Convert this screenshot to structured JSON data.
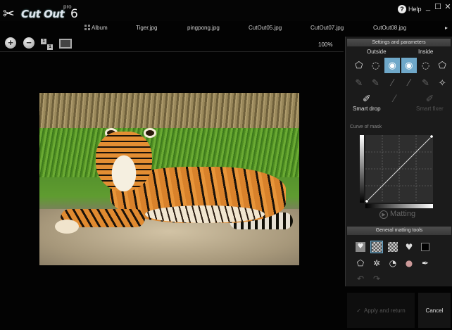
{
  "app": {
    "logo_text": "Cut Out",
    "logo_pro": "pro",
    "logo_version": "6",
    "help_label": "Help"
  },
  "window_controls": {
    "minimize": "_",
    "maximize": "☐",
    "close": "✕"
  },
  "tabs": [
    {
      "label": "Album",
      "icon": "album-grid-icon"
    },
    {
      "label": "Tiger.jpg"
    },
    {
      "label": "pingpong.jpg"
    },
    {
      "label": "CutOut05.jpg"
    },
    {
      "label": "CutOut07.jpg"
    },
    {
      "label": "CutOut08.jpg"
    }
  ],
  "tab_overflow": "▸",
  "toolbar": {
    "zoom_in_icon": "zoom-in-icon",
    "zoom_out_icon": "zoom-out-icon",
    "one_to_one_top": "1",
    "one_to_one_bottom": "1",
    "zoom_level": "100%"
  },
  "panel": {
    "header": "Settings and parameters",
    "outside_label": "Outside",
    "inside_label": "Inside",
    "smart_drop_label": "Smart drop",
    "smart_fixer_label": "Smart fixer",
    "curve_label": "Curve of mask",
    "matting_label": "Matting",
    "general_tools_header": "General matting tools"
  },
  "buttons": {
    "apply": "Apply and return",
    "cancel": "Cancel"
  },
  "colors": {
    "accent": "#6fa8c9",
    "panel_bg": "#1b1b1b",
    "header_bg": "#444444"
  }
}
